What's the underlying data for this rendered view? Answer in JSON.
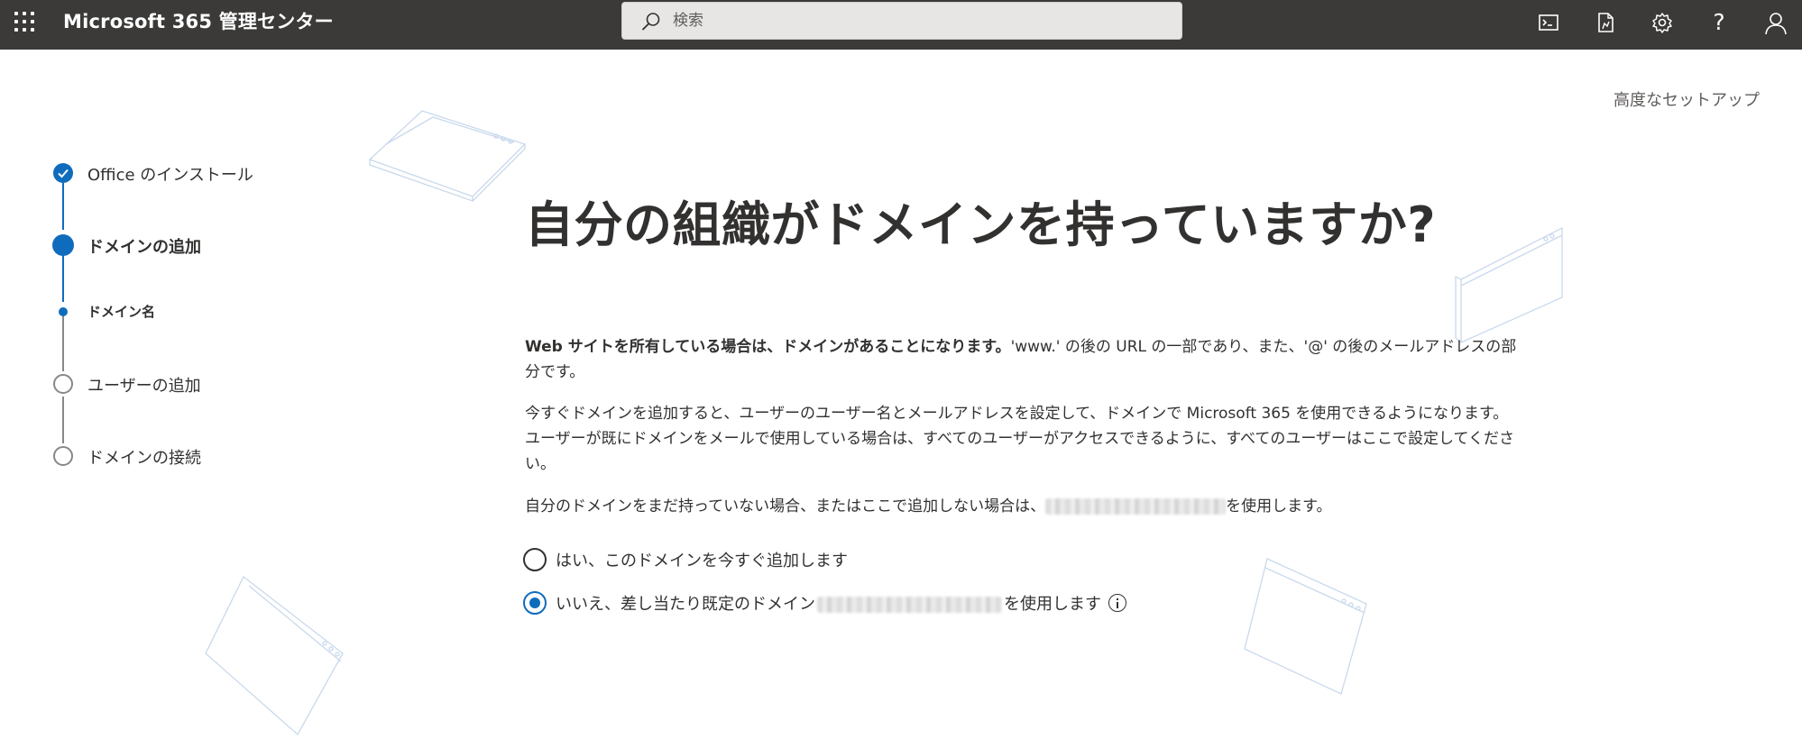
{
  "header": {
    "app_title": "Microsoft 365 管理センター",
    "search_placeholder": "検索",
    "icons": [
      "waffle-icon",
      "terminal-icon",
      "document-icon",
      "gear-icon",
      "help-icon",
      "user-icon"
    ],
    "help_glyph": "?"
  },
  "advanced_setup": "高度なセットアップ",
  "steps": [
    {
      "label": "Office のインストール",
      "state": "completed"
    },
    {
      "label": "ドメインの追加",
      "state": "current"
    },
    {
      "label": "ドメイン名",
      "state": "current-substep"
    },
    {
      "label": "ユーザーの追加",
      "state": "pending"
    },
    {
      "label": "ドメインの接続",
      "state": "pending"
    }
  ],
  "main": {
    "heading": "自分の組織がドメインを持っていますか?",
    "para1_bold": "Web サイトを所有している場合は、ドメインがあることになります。",
    "para1_rest": "'www.' の後の URL の一部であり、また、'@' の後のメールアドレスの部分です。",
    "para2": "今すぐドメインを追加すると、ユーザーのユーザー名とメールアドレスを設定して、ドメインで Microsoft 365 を使用できるようになります。ユーザーが既にドメインをメールで使用している場合は、すべてのユーザーがアクセスできるように、すべてのユーザーはここで設定してください。",
    "para3_before": "自分のドメインをまだ持っていない場合、またはここで追加しない場合は、",
    "para3_after": "を使用します。",
    "options": [
      {
        "label": "はい、このドメインを今すぐ追加します",
        "checked": false
      },
      {
        "label_before": "いいえ、差し当たり既定のドメイン",
        "label_after": "を使用します",
        "checked": true
      }
    ]
  },
  "colors": {
    "topbar": "#3b3a39",
    "accent": "#0f6cbd",
    "text": "#323130"
  }
}
